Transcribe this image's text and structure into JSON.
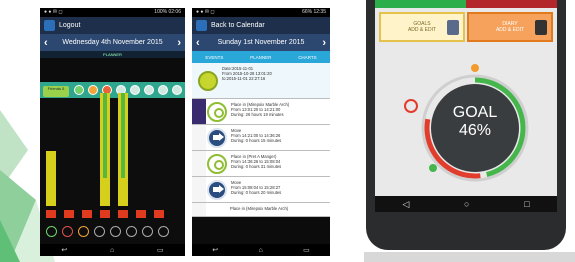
{
  "phone_planner": {
    "status_time": "02:06",
    "status_battery": "100%",
    "appbar_title": "Logout",
    "date": "Wednesday 4th November 2015",
    "tab_label": "PLANNER",
    "badge_text": "Friends 5",
    "prev": "‹",
    "next": "›",
    "nav": [
      "↩",
      "⌂",
      "▭"
    ],
    "colors": {
      "appbar": "#1d2f4a",
      "datebar": "#2c4870",
      "iconrow": "#2ea78e",
      "bar_yellow": "#d6d01d",
      "bar_green": "#55b841",
      "bar_red": "#e03a1f"
    },
    "bars": [
      {
        "group": 1,
        "yellow": 0.44,
        "green": 0.06,
        "red": 0.06
      },
      {
        "group": 2,
        "yellow": 0.0,
        "green": 0.0,
        "red": 0.06
      },
      {
        "group": 3,
        "yellow": 0.0,
        "green": 0.0,
        "red": 0.06
      },
      {
        "group": 4,
        "yellow": 0.9,
        "green": 0.0,
        "red": 0.06
      },
      {
        "group": 5,
        "yellow": 0.9,
        "green": 0.0,
        "red": 0.06
      },
      {
        "group": 6,
        "yellow": 0.0,
        "green": 0.0,
        "red": 0.06
      },
      {
        "group": 7,
        "yellow": 0.0,
        "green": 0.0,
        "red": 0.06
      }
    ]
  },
  "phone_calendar": {
    "status_time": "12:35",
    "status_battery": "66%",
    "appbar_title": "Back to Calendar",
    "date": "Sunday 1st November 2015",
    "prev": "‹",
    "next": "›",
    "tabs": [
      "EVENTS",
      "PLANNER",
      "CHARTS"
    ],
    "nav": [
      "↩",
      "⌂",
      "▭"
    ],
    "entries": [
      {
        "kind": "medal",
        "lines": [
          "Date:2015-11-01",
          "From 2015-10-28 13:01:20",
          "to:2015-11-01 22:27:16"
        ]
      },
      {
        "kind": "pin",
        "lines": [
          "Place in (Mirepoix Marble Arch)",
          "From 13:01:20 to 14:21:00",
          "During: 26 hours 19 minutes"
        ]
      },
      {
        "kind": "arrow",
        "lines": [
          "Move",
          "From 14:21:00 to 14:36:26",
          "During: 0 hours 15 minutes"
        ]
      },
      {
        "kind": "pin",
        "lines": [
          "Place in (Pret A Manger)",
          "From 14:36:26 to 15:08:04",
          "During: 0 hours 31 minutes"
        ]
      },
      {
        "kind": "arrow",
        "lines": [
          "Move",
          "From 15:08:04 to 15:28:27",
          "During: 0 hours 20 minutes"
        ]
      },
      {
        "kind": "pin",
        "lines": [
          "Place in (Mirepoix Marble Arch)"
        ]
      }
    ]
  },
  "phone_goal": {
    "tiles": [
      {
        "title": "GOALS",
        "sub": "ADD & EDIT",
        "color": "#fff3c9",
        "border": "#e6c24a"
      },
      {
        "title": "DIARY",
        "sub": "ADD & EDIT",
        "color": "#f6a25c",
        "border": "#e07a1c"
      }
    ],
    "goal_label": "GOAL",
    "goal_percent": "46%",
    "goal_fraction": 0.46,
    "softkeys": [
      "◁",
      "○",
      "□"
    ],
    "colors": {
      "ring_green": "#44b64b",
      "ring_red": "#e23c2c",
      "center": "#3a3d40",
      "tile_green": "#2cae4a",
      "tile_red": "#b3262a"
    }
  }
}
